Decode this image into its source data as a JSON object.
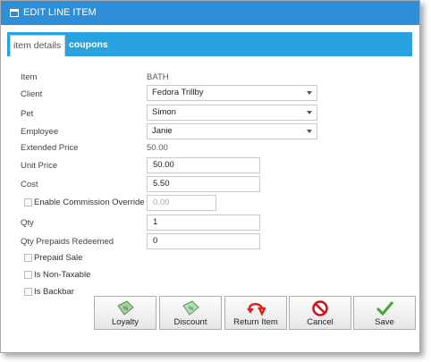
{
  "window": {
    "title": "EDIT LINE ITEM"
  },
  "tabs": [
    {
      "label": "item details"
    },
    {
      "label": "coupons"
    }
  ],
  "form": {
    "item": {
      "label": "Item",
      "value": "BATH"
    },
    "client": {
      "label": "Client",
      "value": "Fedora Trillby"
    },
    "pet": {
      "label": "Pet",
      "value": "Simon"
    },
    "employee": {
      "label": "Employee",
      "value": "Janie"
    },
    "extended_price": {
      "label": "Extended Price",
      "value": "50.00"
    },
    "unit_price": {
      "label": "Unit Price",
      "value": "50.00"
    },
    "cost": {
      "label": "Cost",
      "value": "5.50"
    },
    "commission_override": {
      "label": "Enable Commission Override",
      "value": "0.00"
    },
    "qty": {
      "label": "Qty",
      "value": "1"
    },
    "qty_prepaids": {
      "label": "Qty Prepaids Redeemed",
      "value": "0"
    },
    "prepaid_sale": {
      "label": "Prepaid Sale"
    },
    "non_taxable": {
      "label": "Is Non-Taxable"
    },
    "backbar": {
      "label": "Is Backbar"
    }
  },
  "buttons": {
    "loyalty": "Loyalty",
    "discount": "Discount",
    "return_item": "Return Item",
    "cancel": "Cancel",
    "save": "Save"
  },
  "colors": {
    "titlebar": "#2e8fd8",
    "tabbar": "#29a3e0"
  }
}
